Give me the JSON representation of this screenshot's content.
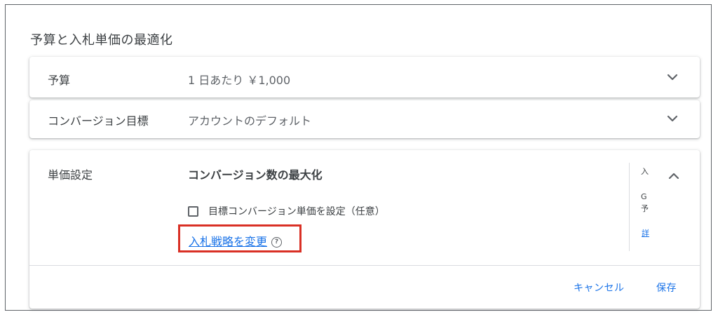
{
  "section": {
    "title": "予算と入札単価の最適化"
  },
  "rows": [
    {
      "label": "予算",
      "value": "1 日あたり ￥1,000",
      "expand_icon": "chevron-down-icon"
    },
    {
      "label": "コンバージョン目標",
      "value": "アカウントのデフォルト",
      "expand_icon": "chevron-down-icon"
    }
  ],
  "bid": {
    "label": "単価設定",
    "strategy": "コンバージョン数の最大化",
    "checkbox_label": "目標コンバージョン単価を設定（任意）",
    "checkbox_checked": false,
    "change_link": "入札戦略を変更",
    "help_icon": "help-circle-icon",
    "help_glyph": "?",
    "collapse_icon": "chevron-up-icon",
    "side_text_1": "入",
    "side_text_2": "G",
    "side_text_3": "予",
    "side_link": "詳"
  },
  "actions": {
    "cancel": "キャンセル",
    "save": "保存"
  },
  "colors": {
    "link": "#1a73e8",
    "highlight_border": "#d93025",
    "text": "#3c4043"
  }
}
